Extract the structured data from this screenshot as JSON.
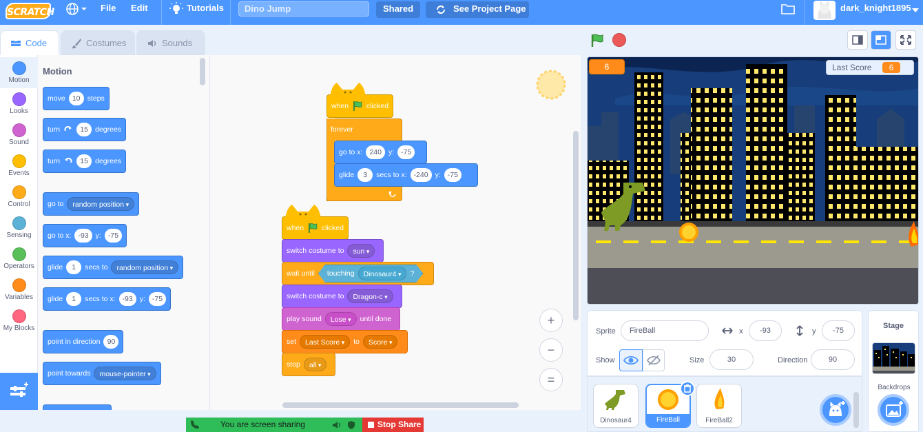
{
  "menubar": {
    "logo": "SCRATCH",
    "file": "File",
    "edit": "Edit",
    "tutorials": "Tutorials",
    "project_title": "Dino Jump",
    "shared": "Shared",
    "see_project_page": "See Project Page",
    "username": "dark_knight1895"
  },
  "tabs": {
    "code": "Code",
    "costumes": "Costumes",
    "sounds": "Sounds"
  },
  "categories": [
    {
      "label": "Motion",
      "color": "#4c97ff"
    },
    {
      "label": "Looks",
      "color": "#9966ff"
    },
    {
      "label": "Sound",
      "color": "#cf63cf"
    },
    {
      "label": "Events",
      "color": "#ffbf00"
    },
    {
      "label": "Control",
      "color": "#ffab19"
    },
    {
      "label": "Sensing",
      "color": "#5cb1d6"
    },
    {
      "label": "Operators",
      "color": "#59c059"
    },
    {
      "label": "Variables",
      "color": "#ff8c1a"
    },
    {
      "label": "My Blocks",
      "color": "#ff6680"
    }
  ],
  "palette": {
    "title": "Motion",
    "move": {
      "a": "move",
      "v": "10",
      "b": "steps"
    },
    "turn_right": {
      "a": "turn",
      "v": "15",
      "b": "degrees"
    },
    "turn_left": {
      "a": "turn",
      "v": "15",
      "b": "degrees"
    },
    "goto": {
      "a": "go to",
      "dd": "random position"
    },
    "goto_xy": {
      "a": "go to x:",
      "x": "-93",
      "b": "y:",
      "y": "-75"
    },
    "glide_rand": {
      "a": "glide",
      "v": "1",
      "b": "secs to",
      "dd": "random position"
    },
    "glide_xy": {
      "a": "glide",
      "v": "1",
      "b": "secs to x:",
      "x": "-93",
      "c": "y:",
      "y": "-75"
    },
    "point_dir": {
      "a": "point in direction",
      "v": "90"
    },
    "point_towards": {
      "a": "point towards",
      "dd": "mouse-pointer"
    }
  },
  "script1": {
    "hat": {
      "a": "when",
      "b": "clicked"
    },
    "forever": "forever",
    "goto": {
      "a": "go to x:",
      "x": "240",
      "b": "y:",
      "y": "-75"
    },
    "glide": {
      "a": "glide",
      "v": "3",
      "b": "secs to x:",
      "x": "-240",
      "c": "y:",
      "y": "-75"
    }
  },
  "script2": {
    "hat": {
      "a": "when",
      "b": "clicked"
    },
    "switch1": {
      "a": "switch costume to",
      "dd": "sun"
    },
    "wait": {
      "a": "wait until",
      "b": "touching",
      "dd": "Dinosaur4",
      "q": "?"
    },
    "switch2": {
      "a": "switch costume to",
      "dd": "Dragon-c"
    },
    "play": {
      "a": "play sound",
      "dd": "Lose",
      "b": "until done"
    },
    "set": {
      "a": "set",
      "dd": "Last Score",
      "b": "to",
      "v": "Score"
    },
    "stop": {
      "a": "stop",
      "dd": "all"
    }
  },
  "zoom": {
    "in": "+",
    "out": "−",
    "reset": "="
  },
  "stage": {
    "score_value": "6",
    "last_score_label": "Last Score",
    "last_score_value": "6"
  },
  "sprite_info": {
    "sprite_label": "Sprite",
    "sprite_name": "FireBall",
    "x_label": "x",
    "x_value": "-93",
    "y_label": "y",
    "y_value": "-75",
    "show_label": "Show",
    "size_label": "Size",
    "size_value": "30",
    "direction_label": "Direction",
    "direction_value": "90"
  },
  "sprites": [
    {
      "name": "Dinosaur4",
      "selected": false
    },
    {
      "name": "FireBall",
      "selected": true
    },
    {
      "name": "FireBall2",
      "selected": false
    }
  ],
  "stage_panel": {
    "title": "Stage",
    "backdrops": "Backdrops"
  },
  "screen_share": {
    "message": "You are screen sharing",
    "stop": "Stop Share"
  }
}
